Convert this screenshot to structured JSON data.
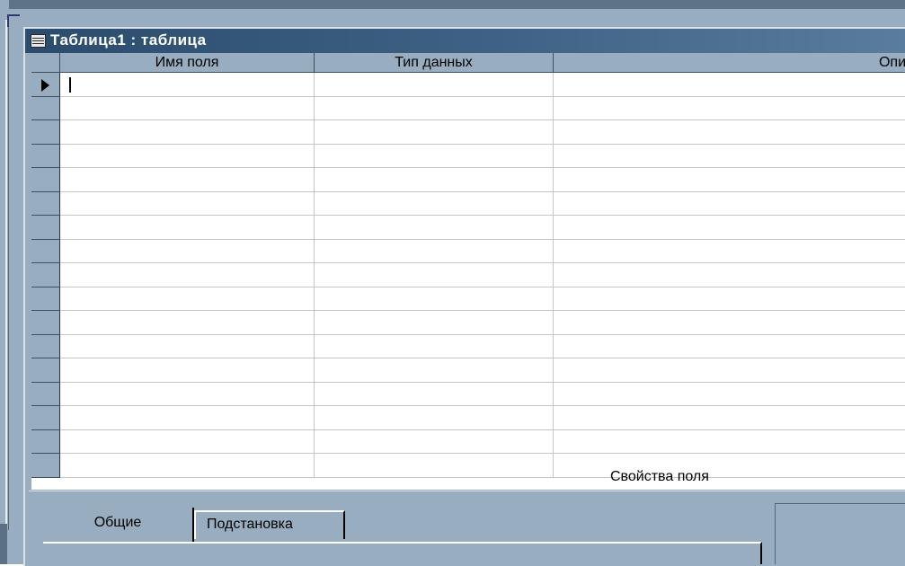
{
  "window": {
    "title": "Таблица1 : таблица"
  },
  "grid": {
    "columns": [
      {
        "header": "Имя поля"
      },
      {
        "header": "Тип данных"
      },
      {
        "header": "Опи"
      }
    ],
    "current_row_indicator": "arrow"
  },
  "properties_panel": {
    "label": "Свойства поля",
    "tabs": [
      {
        "label": "Общие",
        "selected": true
      },
      {
        "label": "Подстановка",
        "selected": false
      }
    ]
  },
  "icons": {
    "window": "table-icon",
    "row_selector": "current-row-arrow-icon"
  },
  "colors": {
    "window_bg": "#98adbf",
    "titlebar": "#2b4c6c",
    "grid_line": "#c6c6c6"
  }
}
